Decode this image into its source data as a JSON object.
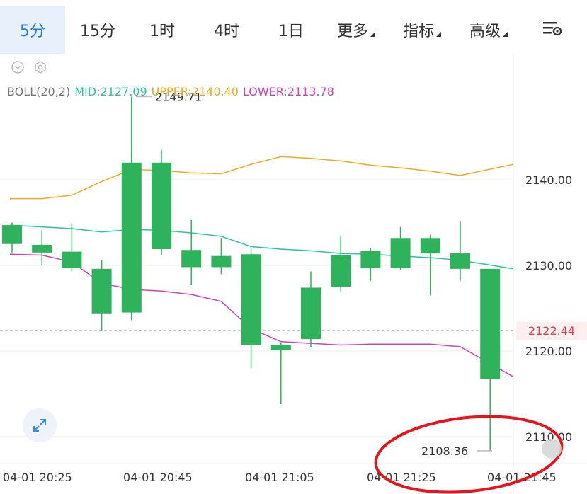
{
  "toolbar": {
    "tabs": [
      {
        "label": "5分",
        "active": true
      },
      {
        "label": "15分",
        "active": false
      },
      {
        "label": "1时",
        "active": false
      },
      {
        "label": "4时",
        "active": false
      },
      {
        "label": "1日",
        "active": false
      },
      {
        "label": "更多",
        "active": false,
        "dropdown": true
      },
      {
        "label": "指标",
        "active": false,
        "dropdown": true
      },
      {
        "label": "高级",
        "active": false,
        "dropdown": true
      }
    ],
    "settings_icon": "chart-settings-icon"
  },
  "indicator": {
    "name": "BOLL(20,2)",
    "mid": "MID:2127.09",
    "upper": "UPPER:2140.40",
    "lower": "LOWER:2113.78"
  },
  "current_price": "2122.44",
  "colors": {
    "up": "#e2465a",
    "down": "#2fb25c",
    "mid": "#2cc3a5",
    "upper": "#f2a81c",
    "lower": "#d63fb4",
    "accent": "#1f7ae0"
  },
  "chart_data": {
    "type": "candlestick",
    "y_ticks": [
      "2140.00",
      "2130.00",
      "2120.00",
      "2110.00"
    ],
    "x_ticks": [
      "04-01 20:25",
      "04-01 20:45",
      "04-01 21:05",
      "04-01 21:25",
      "04-01 21:45"
    ],
    "high_annotation": "2149.71",
    "low_annotation": "2108.36",
    "ylim": [
      2106,
      2150
    ],
    "candles": [
      {
        "open": 2132.5,
        "close": 2134.7,
        "high": 2135.0,
        "low": 2131.5
      },
      {
        "open": 2131.5,
        "close": 2132.4,
        "high": 2134.1,
        "low": 2130.0
      },
      {
        "open": 2129.7,
        "close": 2131.6,
        "high": 2134.9,
        "low": 2129.3
      },
      {
        "open": 2124.4,
        "close": 2129.6,
        "high": 2130.6,
        "low": 2122.4
      },
      {
        "open": 2124.5,
        "close": 2142.0,
        "high": 2149.71,
        "low": 2123.6
      },
      {
        "open": 2131.9,
        "close": 2142.0,
        "high": 2143.5,
        "low": 2131.2
      },
      {
        "open": 2129.8,
        "close": 2131.8,
        "high": 2135.3,
        "low": 2127.7
      },
      {
        "open": 2129.8,
        "close": 2131.1,
        "high": 2133.2,
        "low": 2129.0
      },
      {
        "open": 2120.7,
        "close": 2131.3,
        "high": 2132.0,
        "low": 2118.0
      },
      {
        "open": 2120.1,
        "close": 2120.7,
        "high": 2121.0,
        "low": 2113.8
      },
      {
        "open": 2121.4,
        "close": 2127.4,
        "high": 2129.3,
        "low": 2120.5
      },
      {
        "open": 2127.5,
        "close": 2131.2,
        "high": 2133.5,
        "low": 2127.0
      },
      {
        "open": 2129.7,
        "close": 2131.7,
        "high": 2132.0,
        "low": 2128.2
      },
      {
        "open": 2129.7,
        "close": 2133.2,
        "high": 2134.5,
        "low": 2129.5
      },
      {
        "open": 2131.4,
        "close": 2133.2,
        "high": 2133.6,
        "low": 2126.5
      },
      {
        "open": 2129.6,
        "close": 2131.4,
        "high": 2135.2,
        "low": 2128.2
      },
      {
        "open": 2116.7,
        "close": 2129.6,
        "high": 2129.6,
        "low": 2108.36
      }
    ],
    "upper_band": [
      2137.8,
      2137.8,
      2138.2,
      2139.8,
      2141.2,
      2141.1,
      2140.8,
      2140.7,
      2141.8,
      2142.7,
      2142.5,
      2142.2,
      2141.7,
      2141.4,
      2141.0,
      2140.5,
      2141.8
    ],
    "mid_band": [
      2134.7,
      2134.5,
      2134.3,
      2133.9,
      2134.2,
      2134.1,
      2133.8,
      2133.4,
      2132.2,
      2131.9,
      2131.7,
      2131.4,
      2131.3,
      2131.1,
      2130.9,
      2130.6,
      2129.6
    ],
    "lower_band": [
      2131.3,
      2131.2,
      2130.4,
      2127.9,
      2127.2,
      2127.0,
      2126.6,
      2125.8,
      2122.6,
      2121.1,
      2120.9,
      2120.7,
      2120.8,
      2120.8,
      2120.8,
      2120.5,
      2117.0
    ]
  }
}
